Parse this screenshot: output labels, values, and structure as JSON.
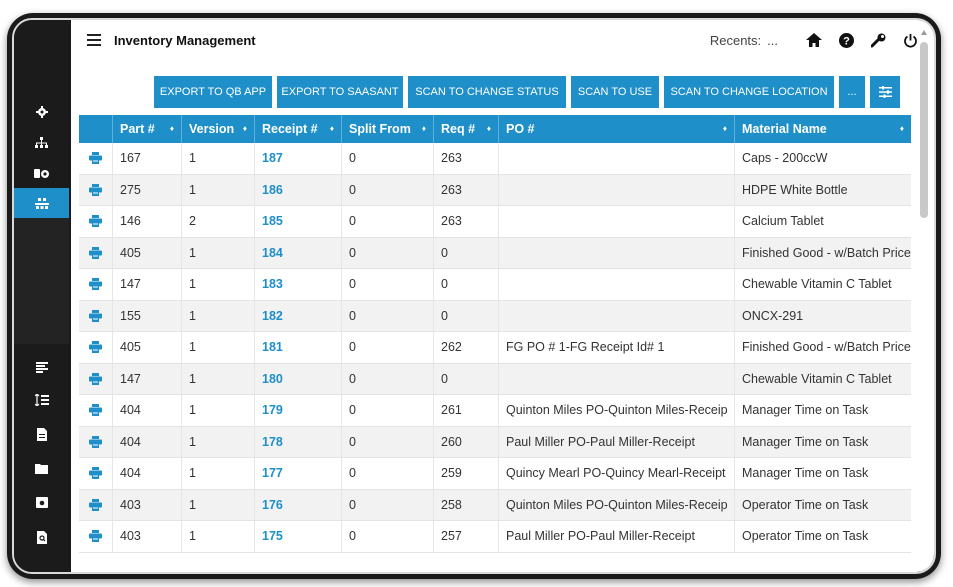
{
  "app": {
    "title": "Inventory Management"
  },
  "topbar": {
    "recents_label": "Recents:",
    "recents_more": "...",
    "icons": [
      "home-icon",
      "help-icon",
      "wrench-icon",
      "power-icon"
    ]
  },
  "sidebar": {
    "items": [
      {
        "icon": "gear-icon",
        "active": false
      },
      {
        "icon": "network-icon",
        "active": false
      },
      {
        "icon": "boxes-icon",
        "active": false
      },
      {
        "icon": "inventory-icon",
        "active": true
      },
      {
        "icon": "list-icon",
        "active": false
      },
      {
        "icon": "sort-list-icon",
        "active": false
      },
      {
        "icon": "document-icon",
        "active": false
      },
      {
        "icon": "folder-icon",
        "active": false
      },
      {
        "icon": "camera-icon",
        "active": false
      },
      {
        "icon": "search-document-icon",
        "active": false
      }
    ]
  },
  "actions": {
    "export_qb": "EXPORT TO QB APP",
    "export_saasant": "EXPORT TO SAASANT",
    "scan_status": "SCAN TO CHANGE STATUS",
    "scan_use": "SCAN TO USE",
    "scan_location": "SCAN TO CHANGE LOCATION",
    "more": "...",
    "filter_icon": "sliders-icon"
  },
  "table": {
    "columns": [
      "Part #",
      "Version",
      "Receipt #",
      "Split From",
      "Req #",
      "PO #",
      "Material Name"
    ],
    "caret": "♦",
    "rows": [
      {
        "part": "167",
        "version": "1",
        "receipt": "187",
        "split": "0",
        "req": "263",
        "po": "",
        "material": "Caps - 200ccW"
      },
      {
        "part": "275",
        "version": "1",
        "receipt": "186",
        "split": "0",
        "req": "263",
        "po": "",
        "material": "HDPE White Bottle"
      },
      {
        "part": "146",
        "version": "2",
        "receipt": "185",
        "split": "0",
        "req": "263",
        "po": "",
        "material": "Calcium Tablet"
      },
      {
        "part": "405",
        "version": "1",
        "receipt": "184",
        "split": "0",
        "req": "0",
        "po": "",
        "material": "Finished Good - w/Batch Price"
      },
      {
        "part": "147",
        "version": "1",
        "receipt": "183",
        "split": "0",
        "req": "0",
        "po": "",
        "material": "Chewable Vitamin C Tablet"
      },
      {
        "part": "155",
        "version": "1",
        "receipt": "182",
        "split": "0",
        "req": "0",
        "po": "",
        "material": "ONCX-291"
      },
      {
        "part": "405",
        "version": "1",
        "receipt": "181",
        "split": "0",
        "req": "262",
        "po": "FG PO # 1-FG Receipt Id# 1",
        "material": "Finished Good - w/Batch Price"
      },
      {
        "part": "147",
        "version": "1",
        "receipt": "180",
        "split": "0",
        "req": "0",
        "po": "",
        "material": "Chewable Vitamin C Tablet"
      },
      {
        "part": "404",
        "version": "1",
        "receipt": "179",
        "split": "0",
        "req": "261",
        "po": "Quinton Miles PO-Quinton Miles-Receip",
        "material": "Manager Time on Task"
      },
      {
        "part": "404",
        "version": "1",
        "receipt": "178",
        "split": "0",
        "req": "260",
        "po": "Paul Miller PO-Paul Miller-Receipt",
        "material": "Manager Time on Task"
      },
      {
        "part": "404",
        "version": "1",
        "receipt": "177",
        "split": "0",
        "req": "259",
        "po": "Quincy Mearl PO-Quincy Mearl-Receipt",
        "material": "Manager Time on Task"
      },
      {
        "part": "403",
        "version": "1",
        "receipt": "176",
        "split": "0",
        "req": "258",
        "po": "Quinton Miles PO-Quinton Miles-Receip",
        "material": "Operator Time on Task"
      },
      {
        "part": "403",
        "version": "1",
        "receipt": "175",
        "split": "0",
        "req": "257",
        "po": "Paul Miller PO-Paul Miller-Receipt",
        "material": "Operator Time on Task"
      }
    ]
  },
  "colors": {
    "accent": "#1e8fc8",
    "sidebar_bg": "#1b1b1b",
    "row_alt": "#f2f2f2"
  }
}
